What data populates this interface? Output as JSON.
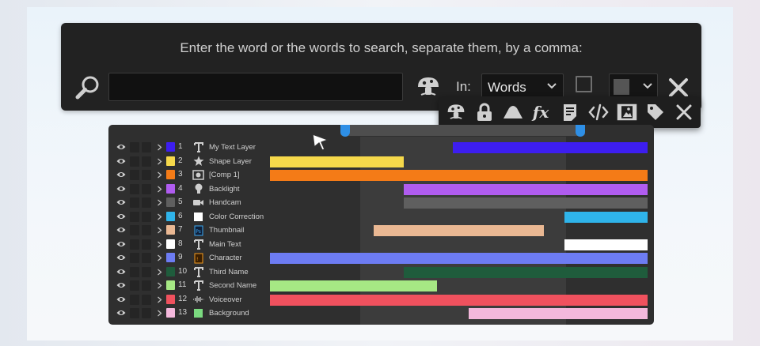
{
  "search": {
    "prompt": "Enter the word or the words to search, separate them, by a comma:",
    "query": "",
    "in_label": "In:",
    "scope": "Words",
    "color_swatch": "#555555"
  },
  "search_in_options": [
    {
      "name": "mushroom-icon"
    },
    {
      "name": "lock-icon"
    },
    {
      "name": "shape-icon"
    },
    {
      "name": "fx-icon",
      "text": "fx"
    },
    {
      "name": "notes-icon"
    },
    {
      "name": "code-icon"
    },
    {
      "name": "footage-icon"
    },
    {
      "name": "tag-icon"
    },
    {
      "name": "close-icon"
    }
  ],
  "layers": [
    {
      "num": "1",
      "name": "My Text Layer",
      "color": "#3d1ef0",
      "type": "text",
      "bar": [
        0.485,
        1.0
      ]
    },
    {
      "num": "2",
      "name": "Shape Layer",
      "color": "#f6d94b",
      "type": "shape",
      "bar": [
        0.0,
        0.355
      ]
    },
    {
      "num": "3",
      "name": "[Comp 1]",
      "color": "#f47b17",
      "type": "comp",
      "bar": [
        0.0,
        1.0
      ]
    },
    {
      "num": "4",
      "name": "Backlight",
      "color": "#b05cf0",
      "type": "light",
      "bar": [
        0.355,
        1.0
      ]
    },
    {
      "num": "5",
      "name": "Handcam",
      "color": "#5f5f5f",
      "type": "camera",
      "bar": [
        0.355,
        1.0
      ]
    },
    {
      "num": "6",
      "name": "Color Correction",
      "color": "#2fb4ea",
      "type": "solid",
      "bar": [
        0.78,
        1.0
      ]
    },
    {
      "num": "7",
      "name": "Thumbnail",
      "color": "#eab893",
      "type": "psd",
      "bar": [
        0.275,
        0.725
      ]
    },
    {
      "num": "8",
      "name": "Main Text",
      "color": "#ffffff",
      "type": "text",
      "bar": [
        0.78,
        1.0
      ]
    },
    {
      "num": "9",
      "name": "Character",
      "color": "#6d7cf3",
      "type": "ai",
      "bar": [
        0.0,
        1.0
      ]
    },
    {
      "num": "10",
      "name": "Third Name",
      "color": "#1f5c3c",
      "type": "text",
      "bar": [
        0.355,
        1.0
      ]
    },
    {
      "num": "11",
      "name": "Second Name",
      "color": "#a6e884",
      "type": "text",
      "bar": [
        0.0,
        0.442
      ]
    },
    {
      "num": "12",
      "name": "Voiceover",
      "color": "#f0515e",
      "type": "audio",
      "bar": [
        0.0,
        1.0
      ]
    },
    {
      "num": "13",
      "name": "Background",
      "color": "#f4b8dc",
      "type": "solid",
      "bar": [
        0.527,
        1.0
      ]
    }
  ],
  "solid_colors": {
    "6": "#ffffff",
    "13": "#7ad97f"
  }
}
